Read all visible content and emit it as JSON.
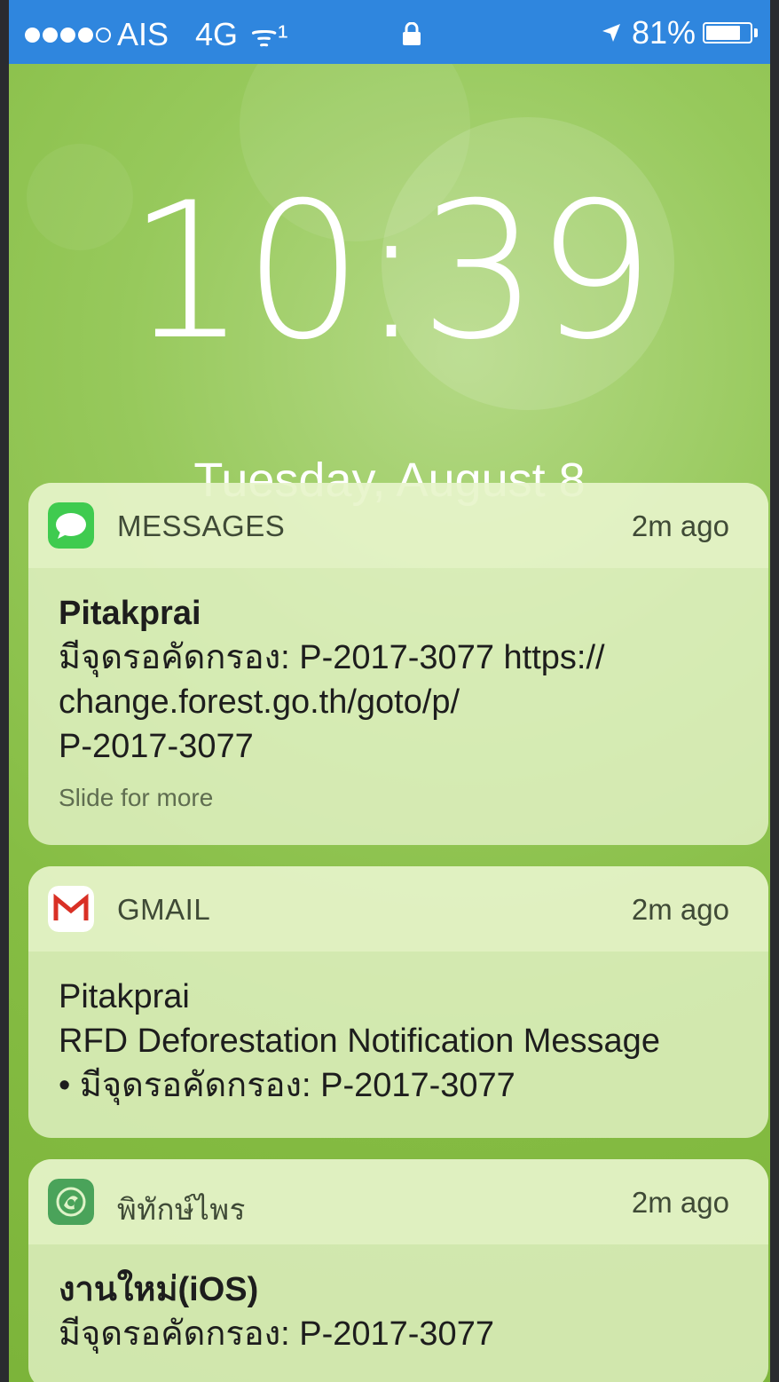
{
  "status_bar": {
    "carrier": "AIS",
    "network": "4G",
    "wifi_symbol": "ᯤ¹",
    "battery_percent": "81%",
    "battery_level": 0.81,
    "signal_bars_filled": 4,
    "signal_bars_total": 5,
    "background_color": "#2f86de"
  },
  "lock_screen": {
    "time": "10:39",
    "date": "Tuesday, August 8",
    "wallpaper_color": "#86bd44"
  },
  "notifications": [
    {
      "app": "MESSAGES",
      "icon": "messages-icon",
      "time": "2m ago",
      "title": "Pitakprai",
      "body_lines": [
        "มีจุดรอคัดกรอง: P-2017-3077 https://",
        "change.forest.go.th/goto/p/",
        "P-2017-3077"
      ],
      "hint": "Slide for more"
    },
    {
      "app": "GMAIL",
      "icon": "gmail-icon",
      "time": "2m ago",
      "title": "Pitakprai",
      "body_lines": [
        "RFD Deforestation Notification Message",
        "• มีจุดรอคัดกรอง: P-2017-3077"
      ]
    },
    {
      "app": "พิทักษ์ไพร",
      "icon": "pitakprai-app-icon",
      "time": "2m ago",
      "title": "งานใหม่(iOS)",
      "body_lines": [
        "มีจุดรอคัดกรอง: P-2017-3077"
      ]
    }
  ]
}
